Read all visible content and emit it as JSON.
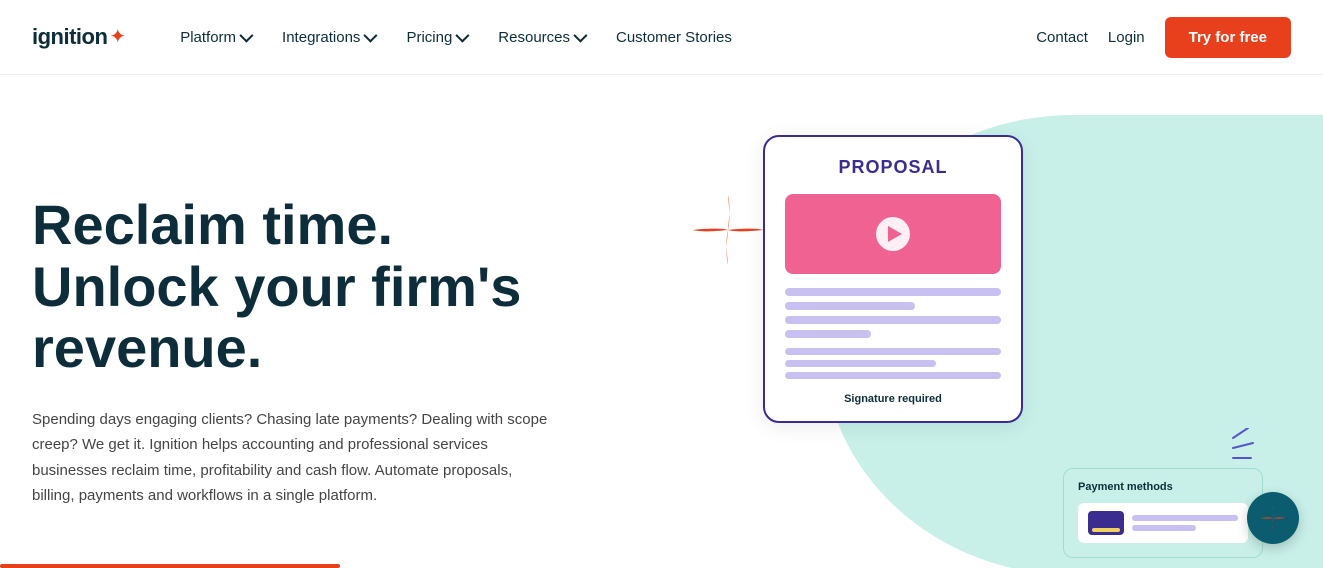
{
  "logo": {
    "text": "ignition",
    "star": "✦"
  },
  "nav": {
    "links": [
      {
        "label": "Platform",
        "hasChevron": true
      },
      {
        "label": "Integrations",
        "hasChevron": true
      },
      {
        "label": "Pricing",
        "hasChevron": true
      },
      {
        "label": "Resources",
        "hasChevron": true
      },
      {
        "label": "Customer Stories",
        "hasChevron": false
      }
    ],
    "contact": "Contact",
    "login": "Login",
    "try_btn": "Try for free"
  },
  "hero": {
    "headline_line1": "Reclaim time.",
    "headline_line2": "Unlock your firm's",
    "headline_line3": "revenue.",
    "subtext": "Spending days engaging clients? Chasing late payments? Dealing with scope creep? We get it. Ignition helps accounting and professional services businesses reclaim time, profitability and cash flow. Automate proposals, billing, payments and workflows in a single platform."
  },
  "proposal_card": {
    "title": "PROPOSAL",
    "signature_label": "Signature required"
  },
  "payment_card": {
    "title": "Payment methods"
  },
  "float_btn": {
    "label": "chat"
  }
}
